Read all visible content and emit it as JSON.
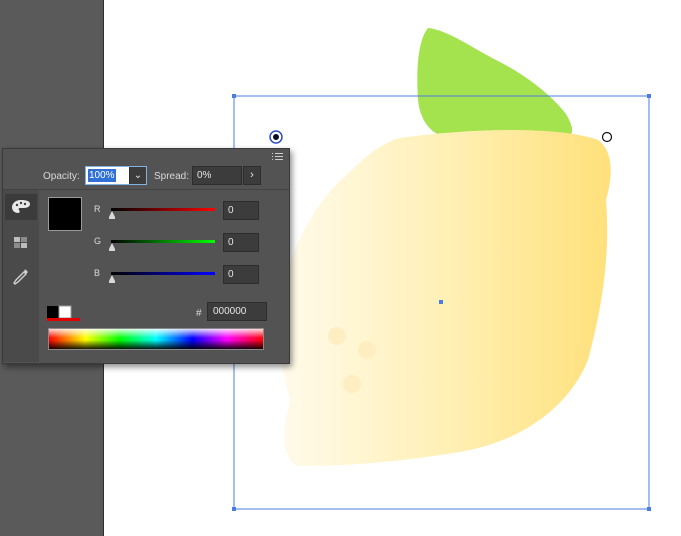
{
  "panel": {
    "opacity_label": "Opacity:",
    "opacity_value": "100%",
    "spread_label": "Spread:",
    "spread_value": "0%",
    "channels": [
      {
        "label": "R",
        "value": "0",
        "track_color": "#ff0000"
      },
      {
        "label": "G",
        "value": "0",
        "track_color": "#00ff00"
      },
      {
        "label": "B",
        "value": "0",
        "track_color": "#0000ff"
      }
    ],
    "hash_label": "#",
    "hex_value": "000000",
    "current_color": "#000000",
    "side_tools": [
      "palette-icon",
      "swatches-grid-icon",
      "eyedropper-icon"
    ]
  },
  "canvas": {
    "lemon_colors": [
      "#fff8dc",
      "#ffe37a"
    ],
    "leaf_color": "#a4e24e",
    "selection_color": "#4a7de0"
  }
}
